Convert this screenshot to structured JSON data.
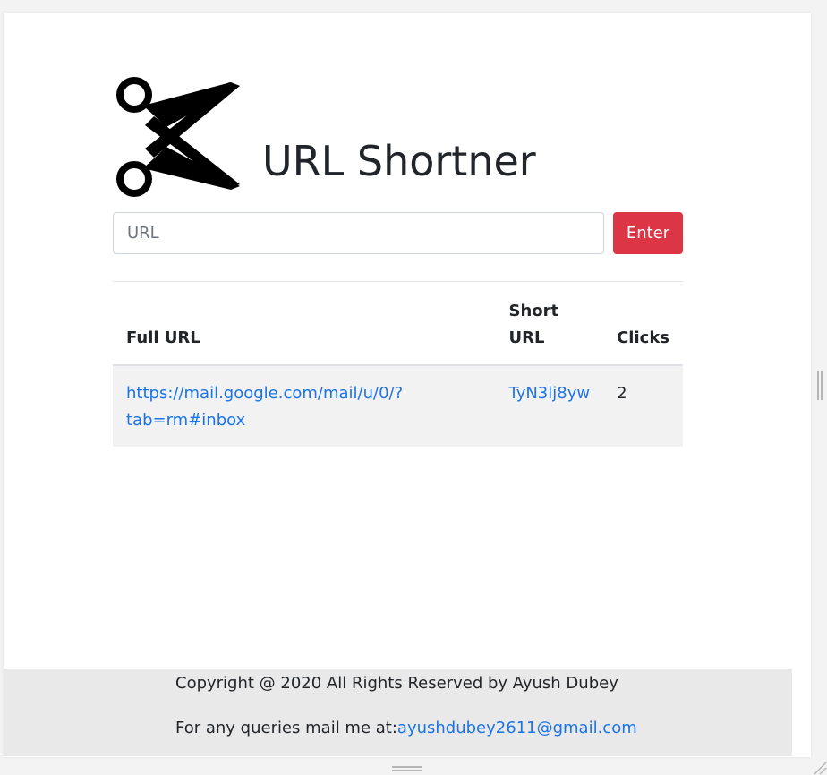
{
  "app": {
    "title": "URL Shortner",
    "logo_icon": "scissors-icon"
  },
  "form": {
    "url_placeholder": "URL",
    "url_value": "",
    "enter_label": "Enter",
    "enter_color": "#dc3545"
  },
  "table": {
    "headers": {
      "full_url": "Full URL",
      "short_url": "Short URL",
      "clicks": "Clicks"
    },
    "rows": [
      {
        "full_url": "https://mail.google.com/mail/u/0/?tab=rm#inbox",
        "short_url": "TyN3lj8yw",
        "clicks": "2"
      }
    ]
  },
  "footer": {
    "copyright": "Copyright @ 2020 All Rights Reserved by Ayush Dubey",
    "contact_prefix": "For any queries mail me at:",
    "contact_email": "ayushdubey2611@gmail.com"
  },
  "colors": {
    "link": "#1a73e8",
    "footer_bg": "#e9e9e9",
    "row_bg": "#f2f2f2"
  }
}
